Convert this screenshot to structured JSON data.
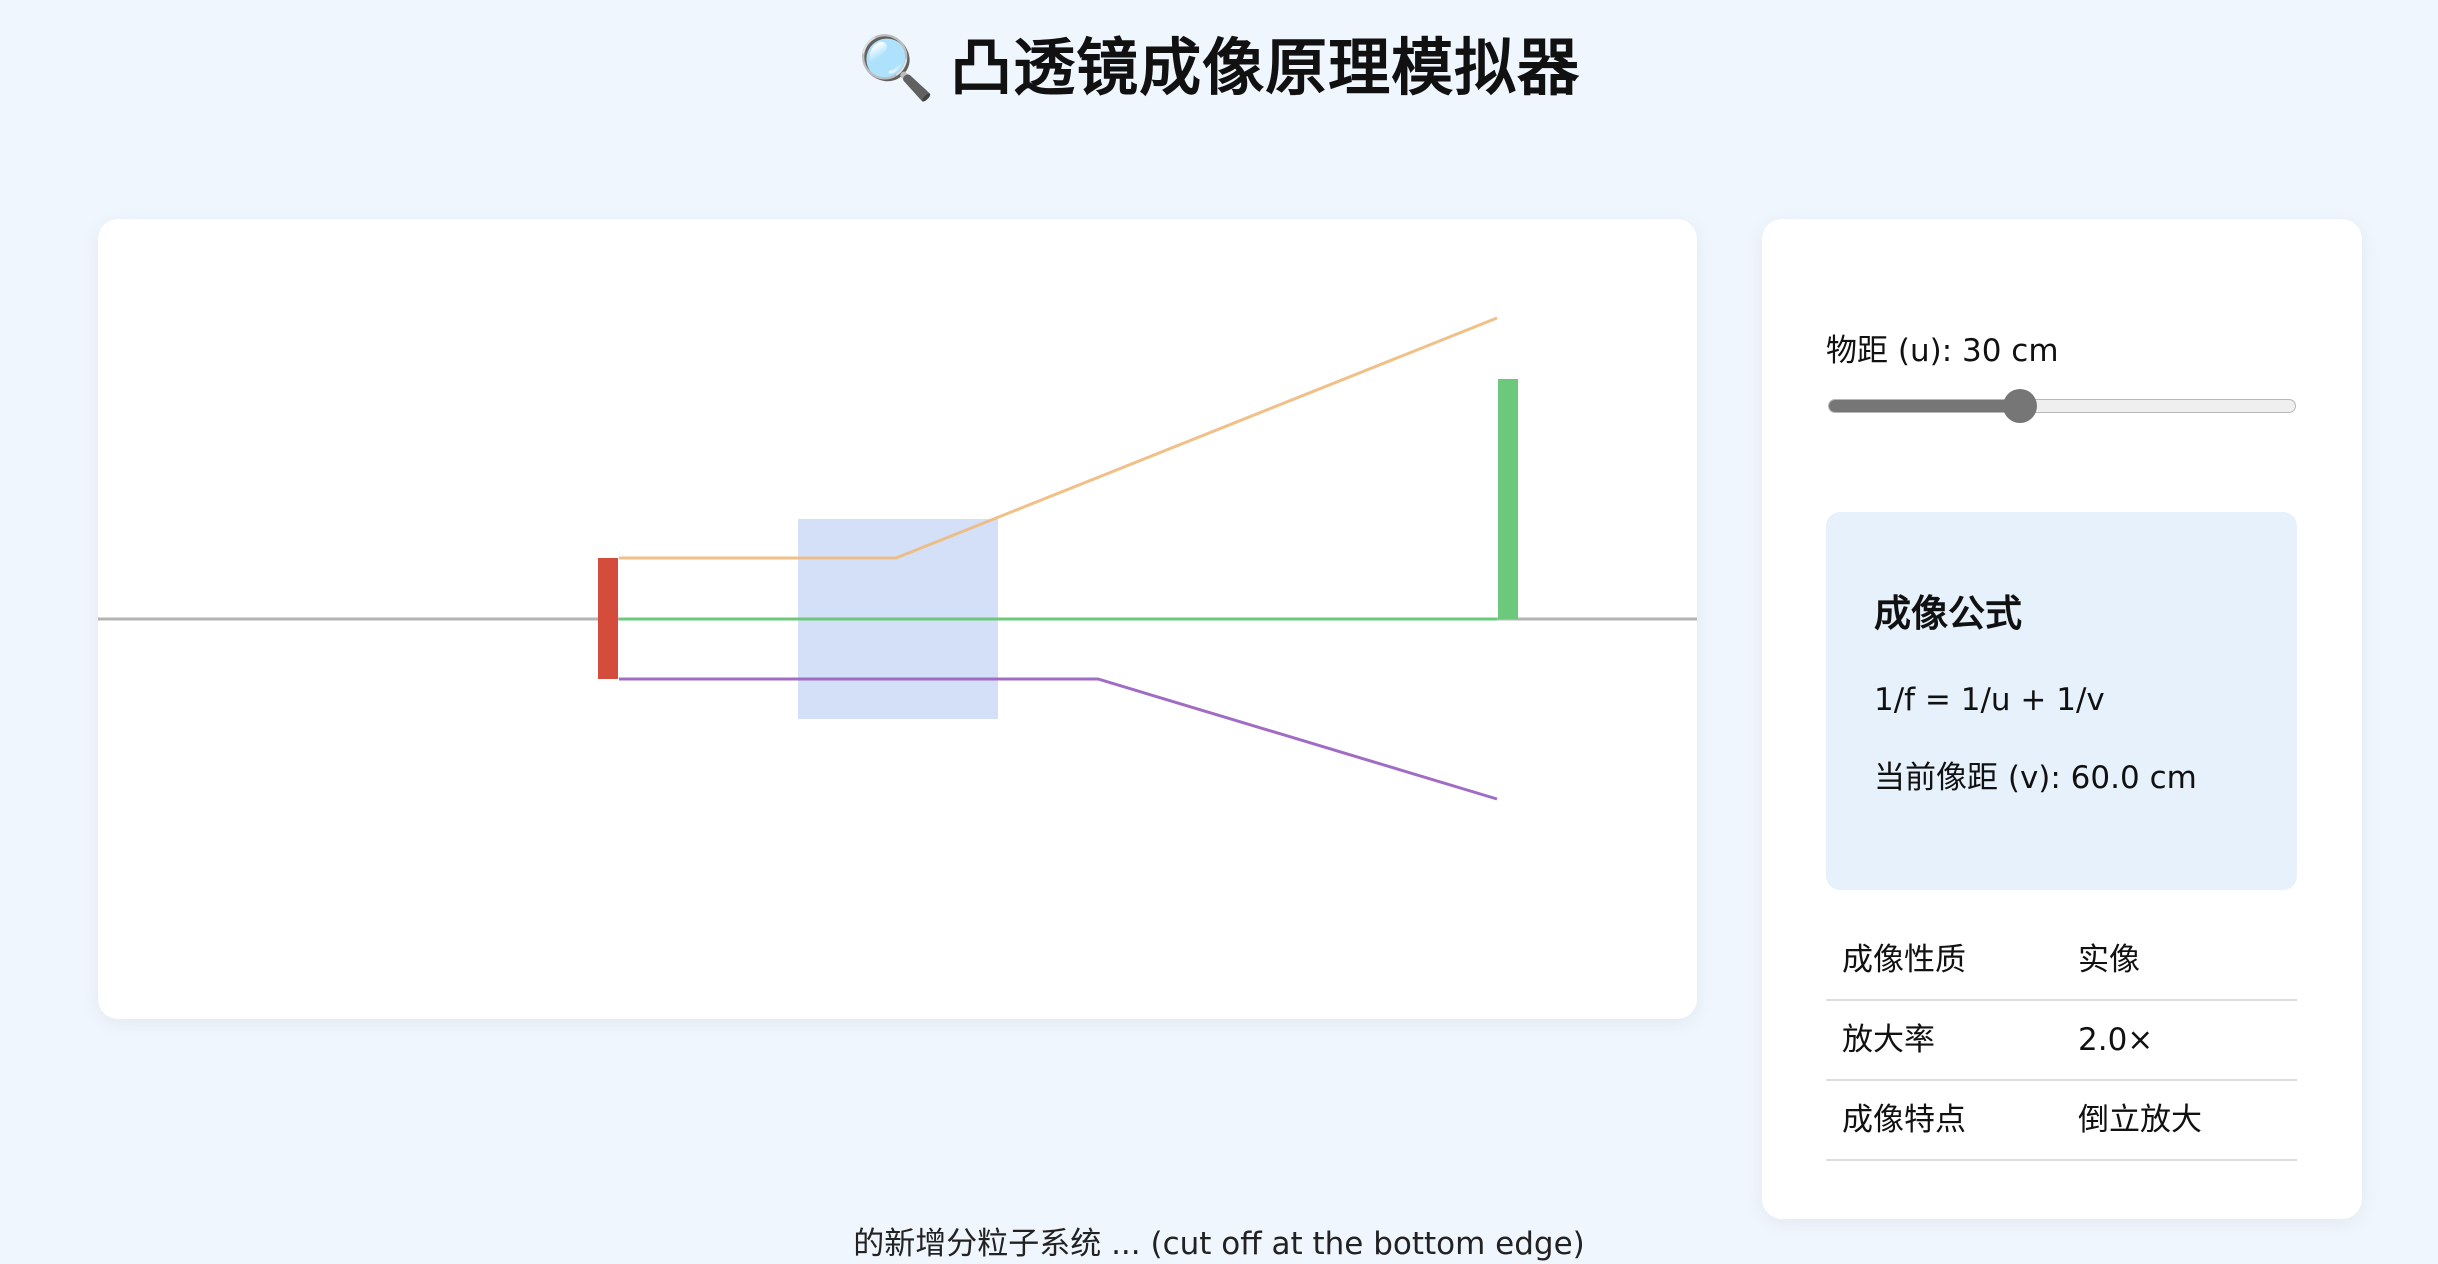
{
  "header": {
    "icon": "🔍",
    "title": "凸透镜成像原理模拟器"
  },
  "controls": {
    "object_distance_label": "物距 (u): 30 cm",
    "object_distance_fraction": 0.41
  },
  "formula": {
    "title": "成像公式",
    "equation": "1/f = 1/u + 1/v",
    "current_image_distance": "当前像距 (v): 60.0 cm"
  },
  "properties": [
    {
      "key": "成像性质",
      "value": "实像"
    },
    {
      "key": "放大率",
      "value": "2.0×"
    },
    {
      "key": "成像特点",
      "value": "倒立放大"
    }
  ],
  "footer": {
    "partial_text": "的新增分粒子系统 ... (cut off at the bottom edge)"
  },
  "colors": {
    "background": "#eff6fe",
    "object": "#d44c3c",
    "image": "#6cc97c",
    "lens": "#d3e0f8",
    "ray_top": "#f0b97a",
    "ray_middle": "#6cc97c",
    "ray_bottom": "#a06cc4",
    "axis": "#b4b4b4"
  }
}
